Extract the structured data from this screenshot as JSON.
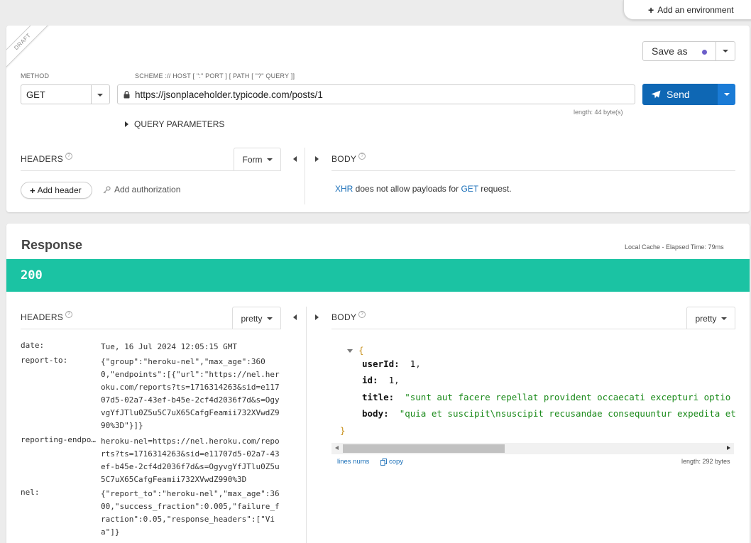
{
  "environment": {
    "add_label": "Add an environment"
  },
  "request": {
    "draft_label": "DRAFT",
    "save_label": "Save as",
    "method_label": "METHOD",
    "method_value": "GET",
    "url_label": "SCHEME :// HOST [ \":\" PORT ] [ PATH [ \"?\" QUERY ]]",
    "url_value": "https://jsonplaceholder.typicode.com/posts/1",
    "url_length": "length: 44 byte(s)",
    "send_label": "Send",
    "query_params_label": "QUERY PARAMETERS",
    "headers_title": "HEADERS",
    "headers_mode": "Form",
    "add_header_label": "Add header",
    "add_auth_label": "Add authorization",
    "body_title": "BODY",
    "body_note": {
      "xhr": "XHR",
      "middle": " does not allow payloads for ",
      "method": "GET",
      "end": " request."
    }
  },
  "response": {
    "title": "Response",
    "timing": "Local Cache - Elapsed Time: 79ms",
    "status_code": "200",
    "headers_title": "HEADERS",
    "headers_mode": "pretty",
    "body_title": "BODY",
    "body_mode": "pretty",
    "headers": [
      {
        "key": "date:",
        "value": "Tue, 16 Jul 2024 12:05:15 GMT"
      },
      {
        "key": "report-to:",
        "value": "{\"group\":\"heroku-nel\",\"max_age\":3600,\"endpoints\":[{\"url\":\"https://nel.heroku.com/reports?ts=1716314263&sid=e11707d5-02a7-43ef-b45e-2cf4d2036f7d&s=OgyvgYfJTlu0Z5u5C7uX65CafgFeamii732XVwdZ990%3D\"}]}"
      },
      {
        "key": "reporting-endpo…",
        "value": "heroku-nel=https://nel.heroku.com/reports?ts=1716314263&sid=e11707d5-02a7-43ef-b45e-2cf4d2036f7d&s=OgyvgYfJTlu0Z5u5C7uX65CafgFeamii732XVwdZ990%3D"
      },
      {
        "key": "nel:",
        "value": "{\"report_to\":\"heroku-nel\",\"max_age\":3600,\"success_fraction\":0.005,\"failure_fraction\":0.05,\"response_headers\":[\"Via\"]}"
      }
    ],
    "body_json": {
      "open_brace": "{",
      "close_brace": "}",
      "fields": [
        {
          "key": "userId:",
          "value": "1",
          "sep": ",",
          "kind": "num"
        },
        {
          "key": "id:",
          "value": "1",
          "sep": ",",
          "kind": "num"
        },
        {
          "key": "title:",
          "value": "\"sunt aut facere repellat provident occaecati excepturi optio reprehenderit\"",
          "sep": ",",
          "kind": "str"
        },
        {
          "key": "body:",
          "value": "\"quia et suscipit\\nsuscipit recusandae consequuntur expedita et cum\\nreprehenderit molestiae ut ut quas totam\\nnostrum rerum est autem sunt rem eveniet architecto\"",
          "sep": "",
          "kind": "str"
        }
      ]
    },
    "lines_nums_label": "lines nums",
    "copy_label": "copy",
    "body_length": "length: 292 bytes"
  },
  "colors": {
    "status_ok": "#1bc3a3",
    "send_button": "#0e67b4",
    "link": "#1a6fb8",
    "json_string": "#1a8a1a"
  }
}
